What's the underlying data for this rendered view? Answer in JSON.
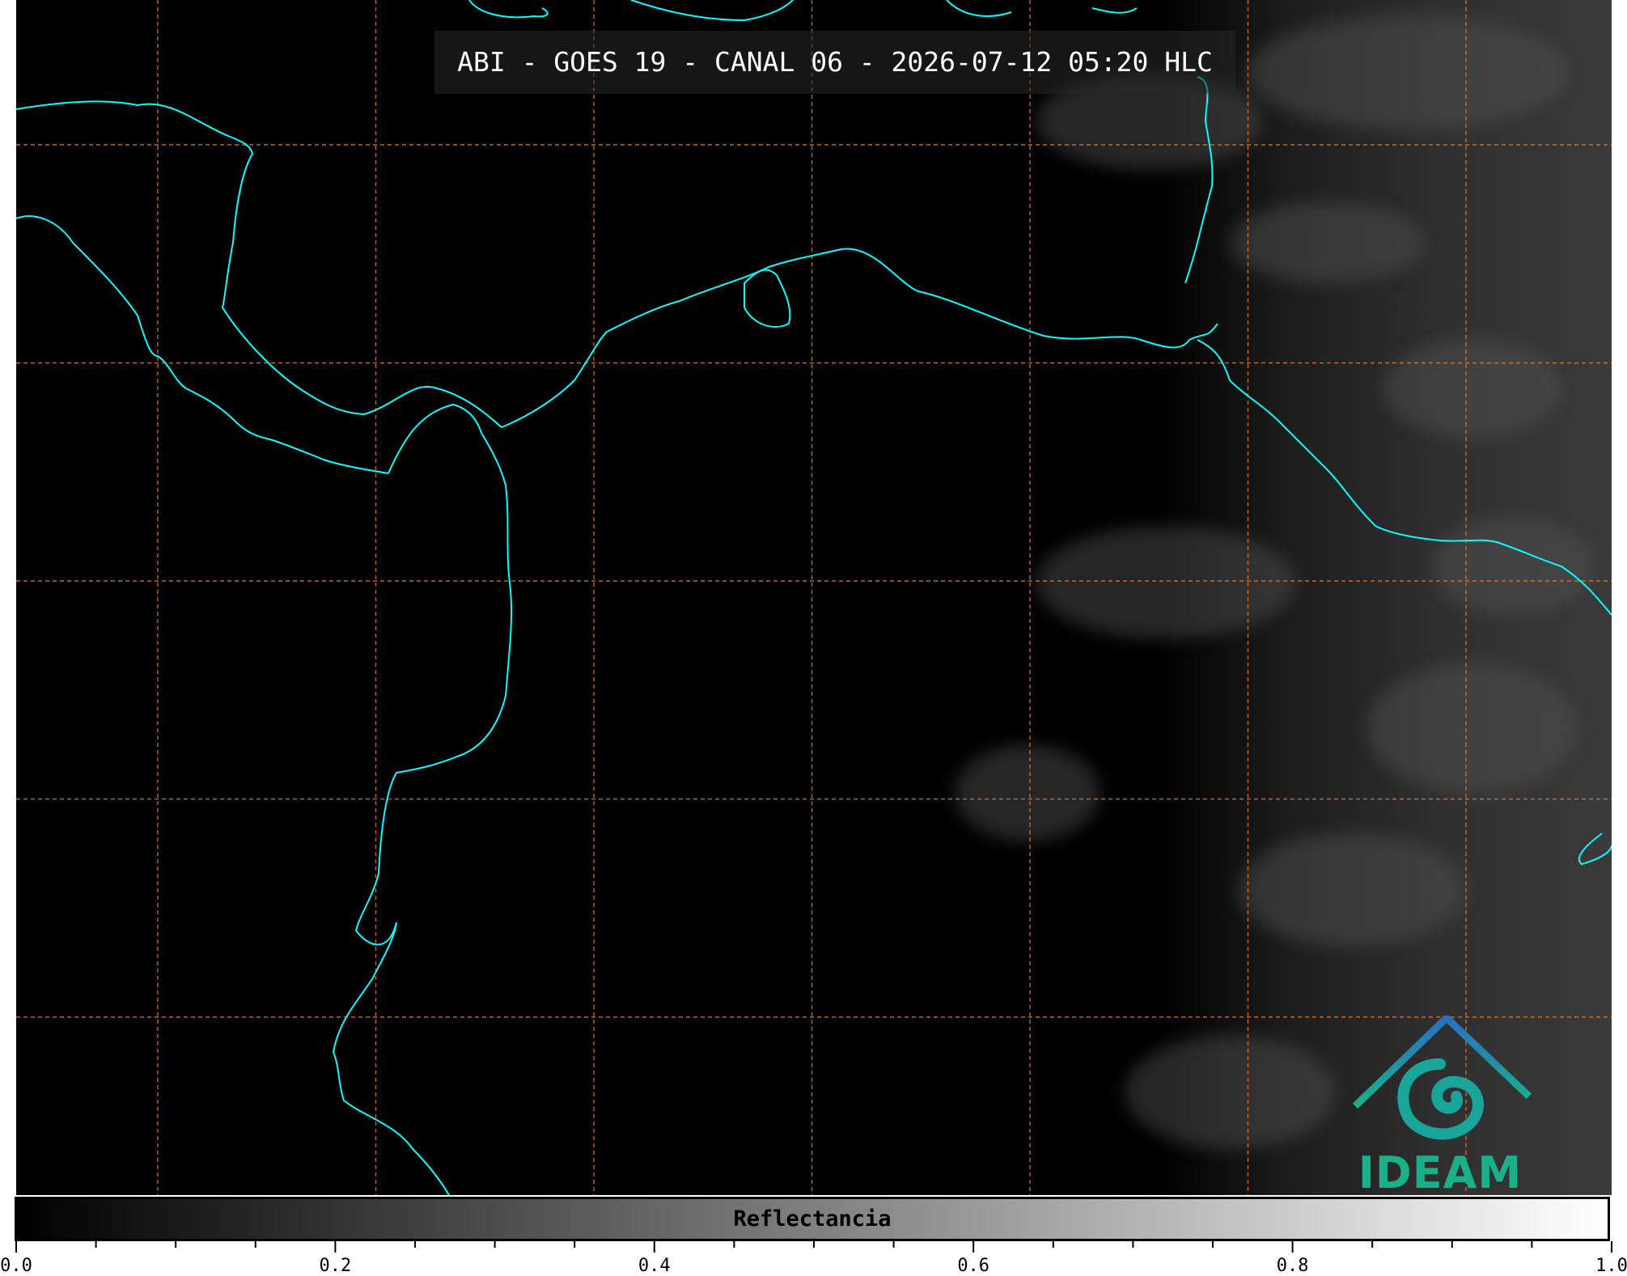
{
  "title": "ABI - GOES 19 - CANAL 06 - 2026-07-12 05:20 HLC",
  "colorbar": {
    "label": "Reflectancia",
    "ticks": [
      "0.0",
      "0.2",
      "0.4",
      "0.6",
      "0.8",
      "1.0"
    ],
    "range": [
      0,
      1
    ],
    "colormap": "grayscale"
  },
  "logo": {
    "text": "IDEAM"
  },
  "colors": {
    "coastline": "#00ffff",
    "grid": "#e0782a",
    "background": "#000000",
    "logo_green": "#19b08a",
    "logo_blue": "#2a6fc0"
  },
  "grid": {
    "style": "dashed",
    "meridians": 7,
    "parallels": 5
  }
}
